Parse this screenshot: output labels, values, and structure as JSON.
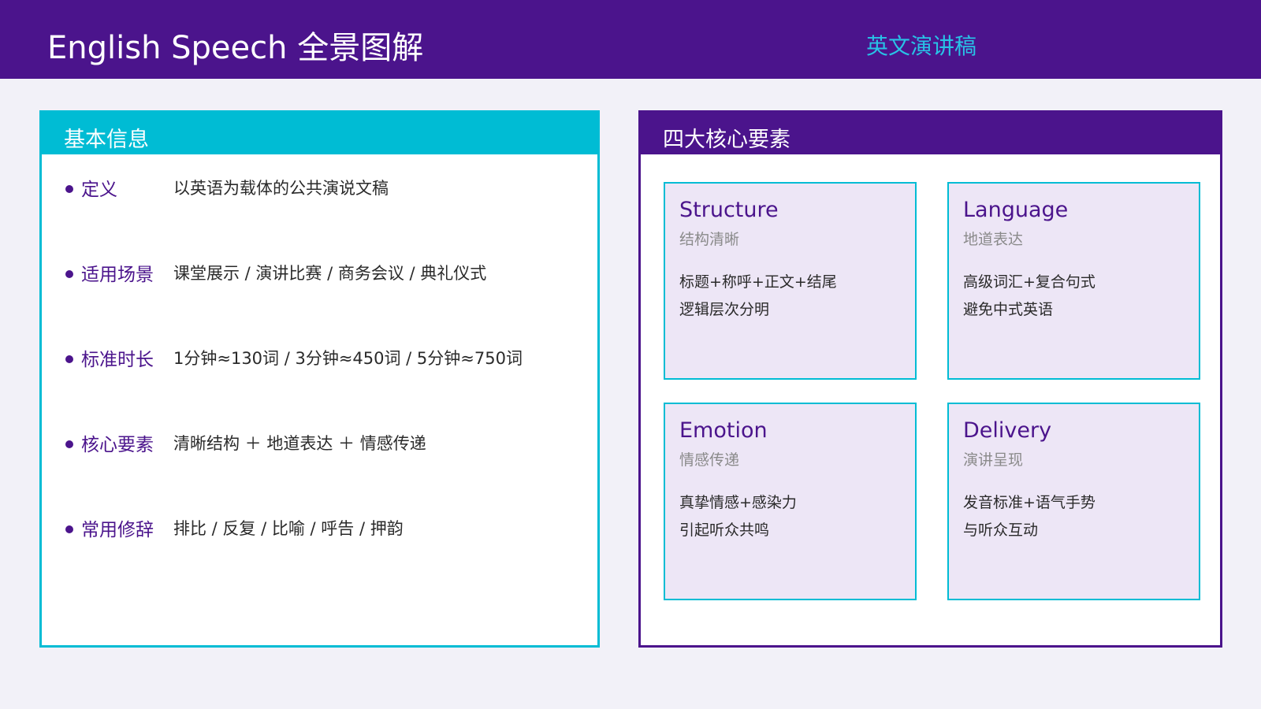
{
  "header": {
    "title": "English Speech 全景图解",
    "subtitle": "英文演讲稿"
  },
  "basic_info": {
    "title": "基本信息",
    "items": [
      {
        "label": "定义",
        "value": "以英语为载体的公共演说文稿"
      },
      {
        "label": "适用场景",
        "value": "课堂展示 / 演讲比赛 / 商务会议 / 典礼仪式"
      },
      {
        "label": "标准时长",
        "value": "1分钟≈130词 / 3分钟≈450词 / 5分钟≈750词"
      },
      {
        "label": "核心要素",
        "value": "清晰结构 ＋ 地道表达 ＋ 情感传递"
      },
      {
        "label": "常用修辞",
        "value": "排比 / 反复 / 比喻 / 呼告 / 押韵"
      }
    ]
  },
  "core_elements": {
    "title": "四大核心要素",
    "cards": [
      {
        "title": "Structure",
        "subtitle": "结构清晰",
        "lines": [
          "标题+称呼+正文+结尾",
          "逻辑层次分明"
        ]
      },
      {
        "title": "Language",
        "subtitle": "地道表达",
        "lines": [
          "高级词汇+复合句式",
          "避免中式英语"
        ]
      },
      {
        "title": "Emotion",
        "subtitle": "情感传递",
        "lines": [
          "真挚情感+感染力",
          "引起听众共鸣"
        ]
      },
      {
        "title": "Delivery",
        "subtitle": "演讲呈现",
        "lines": [
          "发音标准+语气手势",
          "与听众互动"
        ]
      }
    ]
  },
  "colors": {
    "brand_purple": "#4b148c",
    "accent_cyan": "#00bcd4",
    "subtitle_cyan": "#28c2e6",
    "card_bg": "#ede6f6",
    "page_bg": "#f2f1f8"
  }
}
